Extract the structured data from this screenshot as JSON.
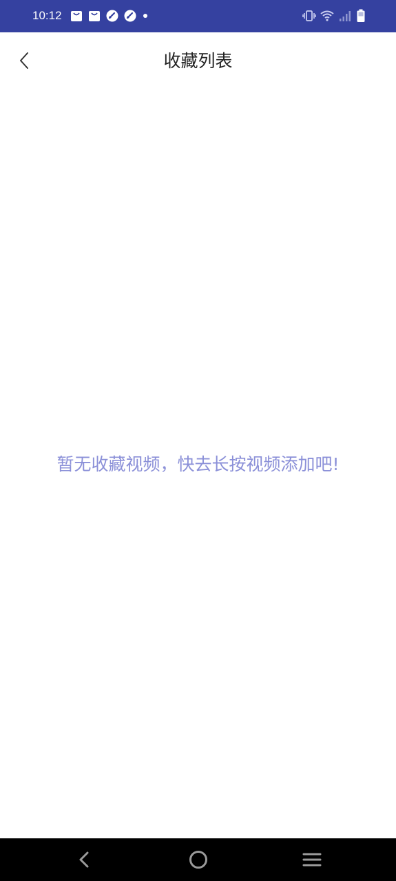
{
  "status_bar": {
    "time": "10:12",
    "left_icons": [
      "bag-notification-icon",
      "bag-notification-icon",
      "speed-notification-icon",
      "speed-notification-icon",
      "more-dot-icon"
    ],
    "right_icons": [
      "vibrate-icon",
      "wifi-icon",
      "signal-icon",
      "battery-icon"
    ],
    "background": "#3541a0"
  },
  "header": {
    "title": "收藏列表",
    "back_icon": "chevron-left-icon"
  },
  "empty_state": {
    "message": "暂无收藏视频，快去长按视频添加吧!",
    "color": "#8b90d8"
  },
  "nav_bar": {
    "buttons": [
      "back-triangle-icon",
      "home-circle-icon",
      "recents-menu-icon"
    ]
  }
}
